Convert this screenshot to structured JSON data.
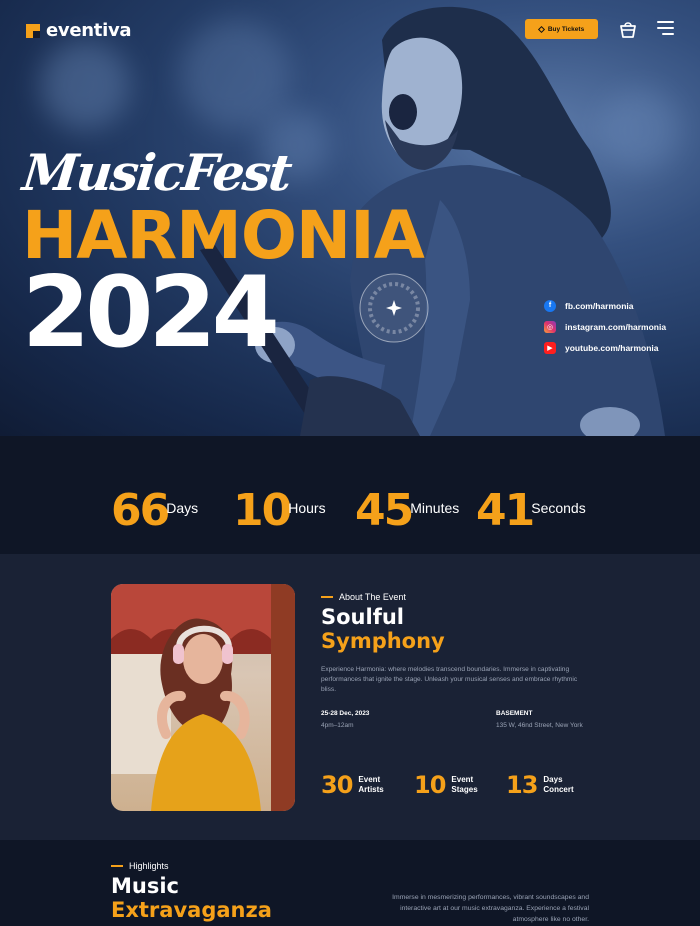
{
  "brand": {
    "name": "eventiva"
  },
  "header": {
    "buy_tickets_label": "Buy Tickets"
  },
  "hero": {
    "script_title": "MusicFest",
    "title": "HARMONIA",
    "year": "2024",
    "socials": [
      {
        "icon": "facebook-icon",
        "label": "fb.com/harmonia"
      },
      {
        "icon": "instagram-icon",
        "label": "instagram.com/harmonia"
      },
      {
        "icon": "youtube-icon",
        "label": "youtube.com/harmonia"
      }
    ]
  },
  "countdown": [
    {
      "value": "66",
      "label": "Days"
    },
    {
      "value": "10",
      "label": "Hours"
    },
    {
      "value": "45",
      "label": "Minutes"
    },
    {
      "value": "41",
      "label": "Seconds"
    }
  ],
  "about": {
    "eyebrow": "About The Event",
    "title_line1": "Soulful",
    "title_line2": "Symphony",
    "description": "Experience Harmonia: where melodies transcend boundaries. Immerse in captivating performances that ignite the stage. Unleash your musical senses and embrace rhythmic bliss.",
    "date": "25-28 Dec, 2023",
    "time": "4pm–12am",
    "venue": "BASEMENT",
    "address": "135 W, 46nd Street, New York",
    "stats": [
      {
        "value": "30",
        "label_line1": "Event",
        "label_line2": "Artists"
      },
      {
        "value": "10",
        "label_line1": "Event",
        "label_line2": "Stages"
      },
      {
        "value": "13",
        "label_line1": "Days",
        "label_line2": "Concert"
      }
    ]
  },
  "highlights": {
    "eyebrow": "Highlights",
    "title_line1": "Music",
    "title_line2": "Extravaganza",
    "description": "Immerse in mesmerizing performances, vibrant soundscapes and interactive art at our music extravaganza. Experience a festival atmosphere like no other."
  },
  "colors": {
    "accent": "#f5a11a",
    "dark_bg": "#0f1626",
    "section_bg": "#1a2235"
  }
}
